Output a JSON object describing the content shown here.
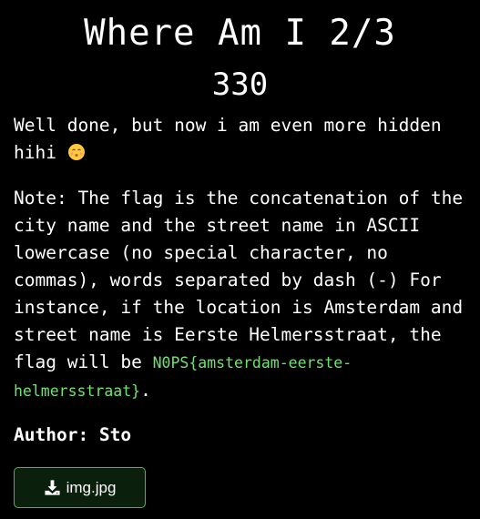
{
  "challenge": {
    "title": "Where Am I 2/3",
    "points": "330",
    "intro_text": "Well done, but now i am even more hidden hihi",
    "intro_emoji": "face-blowing-kiss-icon",
    "note_text": "Note: The flag is the concatenation of the city name and the street name in ASCII lowercase (no special character, no commas), words separated by dash (-) For instance, if the location is Amsterdam and street name is Eerste Helmersstraat, the flag will be ",
    "flag_example": "N0PS{amsterdam-eerste-helmersstraat}",
    "note_end": ".",
    "author_label": "Author: Sto"
  },
  "download": {
    "icon": "download-icon",
    "label": "img.jpg"
  },
  "colors": {
    "background": "#000000",
    "text": "#ffffff",
    "flag_text": "#6fe36f",
    "button_border": "#3fbf4a",
    "button_background": "#0a1f0c"
  }
}
